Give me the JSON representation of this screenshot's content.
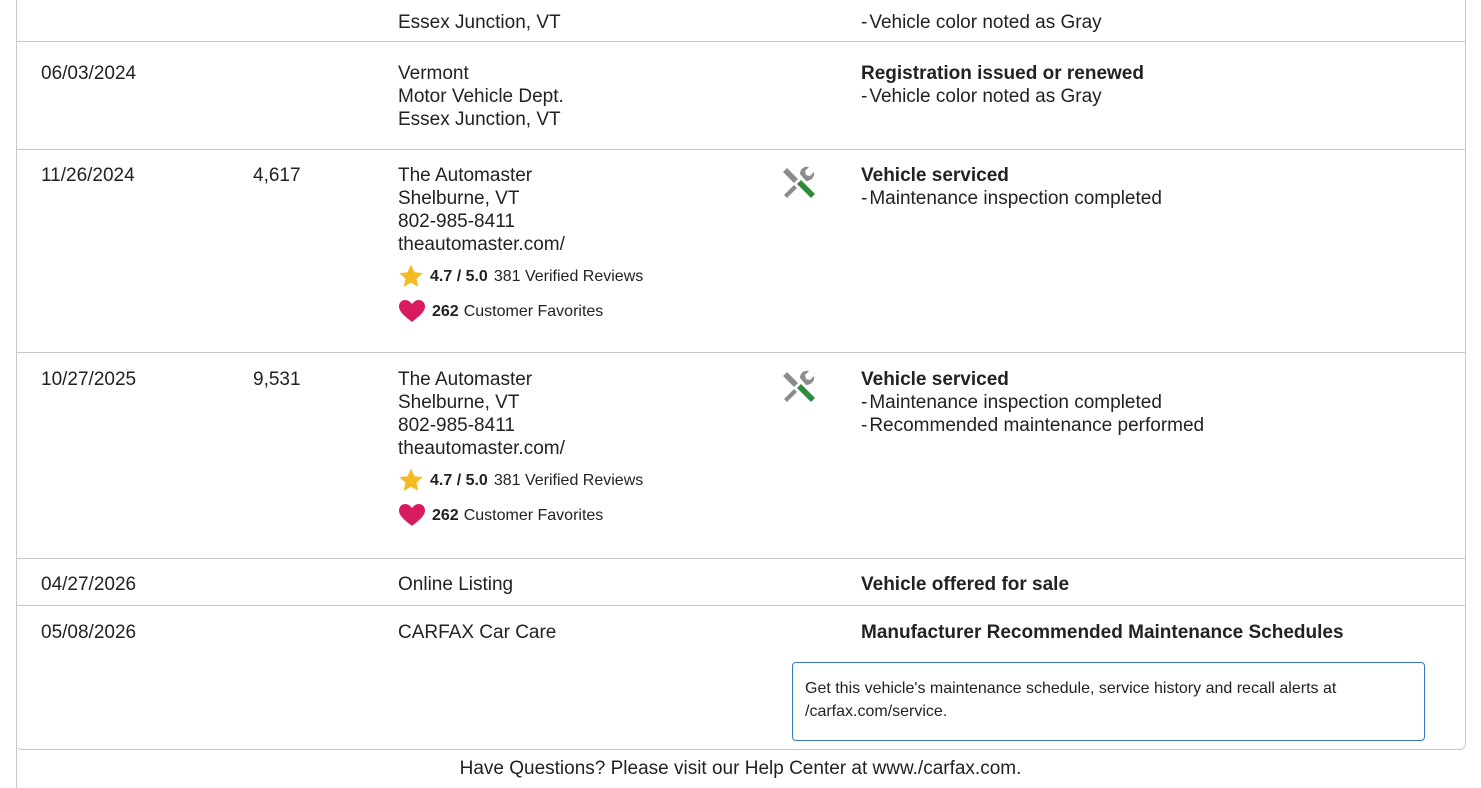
{
  "rows": [
    {
      "date": "",
      "odometer": "",
      "source": [
        "Essex Junction, VT"
      ],
      "title": "",
      "bullets": [
        "Vehicle color noted as Gray"
      ]
    },
    {
      "date": "06/03/2024",
      "odometer": "",
      "source": [
        "Vermont",
        "Motor Vehicle Dept.",
        "Essex Junction, VT"
      ],
      "title": "Registration issued or renewed",
      "bullets": [
        "Vehicle color noted as Gray"
      ]
    },
    {
      "date": "11/26/2024",
      "odometer": "4,617",
      "source": [
        "The Automaster",
        "Shelburne, VT",
        "802-985-8411",
        "theautomaster.com/"
      ],
      "rating": {
        "score": "4.7 / 5.0",
        "reviews": "381 Verified Reviews"
      },
      "favorites": {
        "count": "262",
        "label": "Customer Favorites"
      },
      "icon": "service-tools-icon",
      "title": "Vehicle serviced",
      "bullets": [
        "Maintenance inspection completed"
      ]
    },
    {
      "date": "10/27/2025",
      "odometer": "9,531",
      "source": [
        "The Automaster",
        "Shelburne, VT",
        "802-985-8411",
        "theautomaster.com/"
      ],
      "rating": {
        "score": "4.7 / 5.0",
        "reviews": "381 Verified Reviews"
      },
      "favorites": {
        "count": "262",
        "label": "Customer Favorites"
      },
      "icon": "service-tools-icon",
      "title": "Vehicle serviced",
      "bullets": [
        "Maintenance inspection completed",
        "Recommended maintenance performed"
      ]
    },
    {
      "date": "04/27/2026",
      "odometer": "",
      "source": [
        "Online Listing"
      ],
      "title": "Vehicle offered for sale",
      "bullets": []
    },
    {
      "date": "05/08/2026",
      "odometer": "",
      "source": [
        "CARFAX Car Care"
      ],
      "title": "Manufacturer Recommended Maintenance Schedules",
      "bullets": []
    }
  ],
  "bullet_dash": "-",
  "care_box": {
    "text": "Get this vehicle's maintenance schedule, service history and recall alerts at /carfax.com/service."
  },
  "footer": {
    "help_text": "Have Questions? Please visit our Help Center at www./carfax.com."
  },
  "colors": {
    "divider": "#c8c8c8",
    "star": "#f5b921",
    "heart": "#d81b60",
    "tool_gray": "#8c8c8c",
    "tool_green": "#2e8b3c",
    "care_border": "#3777bc"
  }
}
